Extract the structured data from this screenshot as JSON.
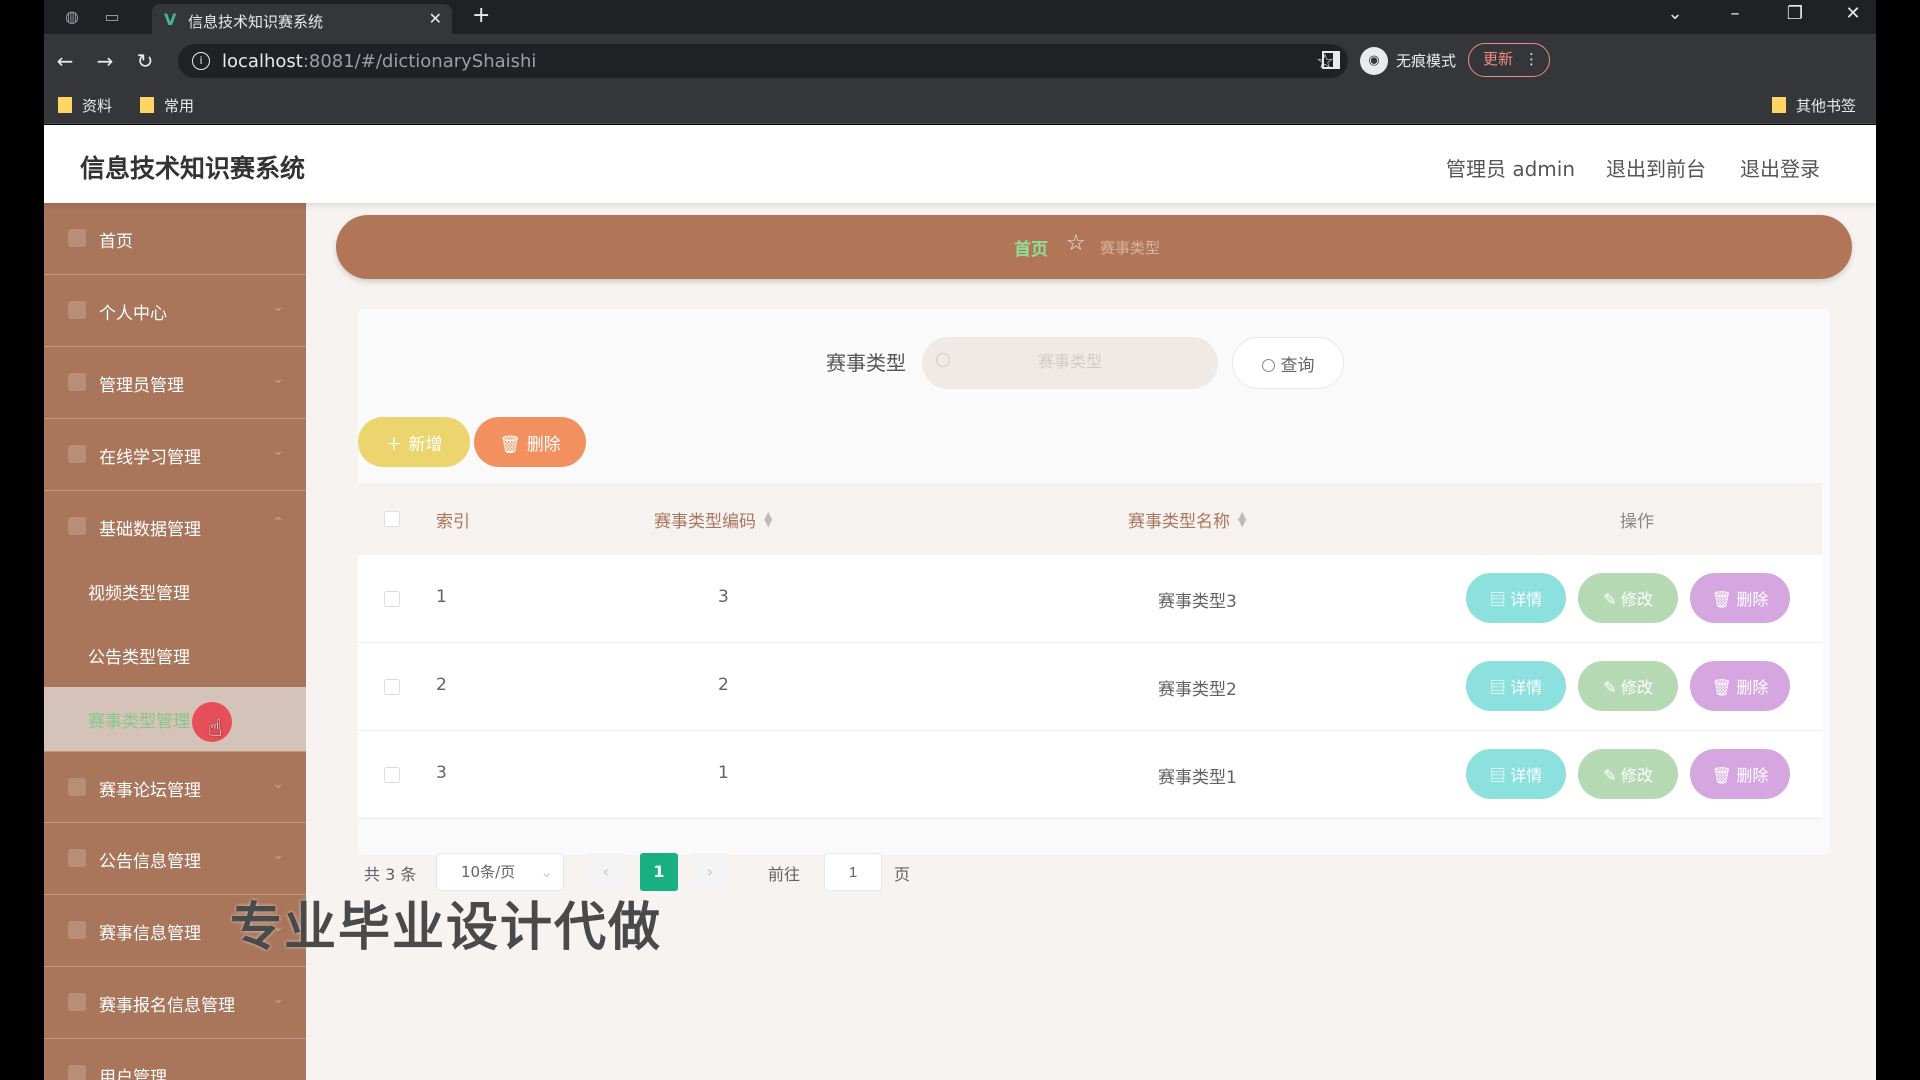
{
  "browser": {
    "tab_title": "信息技术知识赛系统",
    "url_host": "localhost",
    "url_rest": ":8081/#/dictionaryShaishi",
    "incognito_label": "无痕模式",
    "update_label": "更新",
    "bookmarks": [
      "资料",
      "常用"
    ],
    "other_bookmarks": "其他书签"
  },
  "header": {
    "title": "信息技术知识赛系统",
    "user": "管理员 admin",
    "to_front": "退出到前台",
    "logout": "退出登录"
  },
  "sidebar": {
    "items": [
      {
        "label": "首页"
      },
      {
        "label": "个人中心"
      },
      {
        "label": "管理员管理"
      },
      {
        "label": "在线学习管理"
      },
      {
        "label": "基础数据管理"
      }
    ],
    "sub_items": [
      {
        "label": "视频类型管理"
      },
      {
        "label": "公告类型管理"
      },
      {
        "label": "赛事类型管理"
      }
    ],
    "items_after": [
      {
        "label": "赛事论坛管理"
      },
      {
        "label": "公告信息管理"
      },
      {
        "label": "赛事信息管理"
      },
      {
        "label": "赛事报名信息管理"
      },
      {
        "label": "用户管理"
      }
    ]
  },
  "breadcrumb": {
    "home": "首页",
    "current": "赛事类型"
  },
  "search": {
    "label": "赛事类型",
    "placeholder": "赛事类型",
    "button": "查询"
  },
  "actions": {
    "add": "新增",
    "delete": "删除"
  },
  "table": {
    "columns": [
      "索引",
      "赛事类型编码",
      "赛事类型名称",
      "操作"
    ],
    "rows": [
      {
        "index": "1",
        "code": "3",
        "name": "赛事类型3"
      },
      {
        "index": "2",
        "code": "2",
        "name": "赛事类型2"
      },
      {
        "index": "3",
        "code": "1",
        "name": "赛事类型1"
      }
    ],
    "row_actions": {
      "detail": "详情",
      "edit": "修改",
      "remove": "删除"
    }
  },
  "pagination": {
    "total": "共 3 条",
    "page_size": "10条/页",
    "current_page": "1",
    "goto_label": "前往",
    "goto_value": "1",
    "page_suffix": "页"
  },
  "watermark": "专业毕业设计代做",
  "colors": {
    "sidebar": "#a9765c",
    "breadcrumb": "#b07657",
    "accent_green": "#18b081",
    "add_button": "#ecd56e",
    "delete_button": "#f29060"
  }
}
